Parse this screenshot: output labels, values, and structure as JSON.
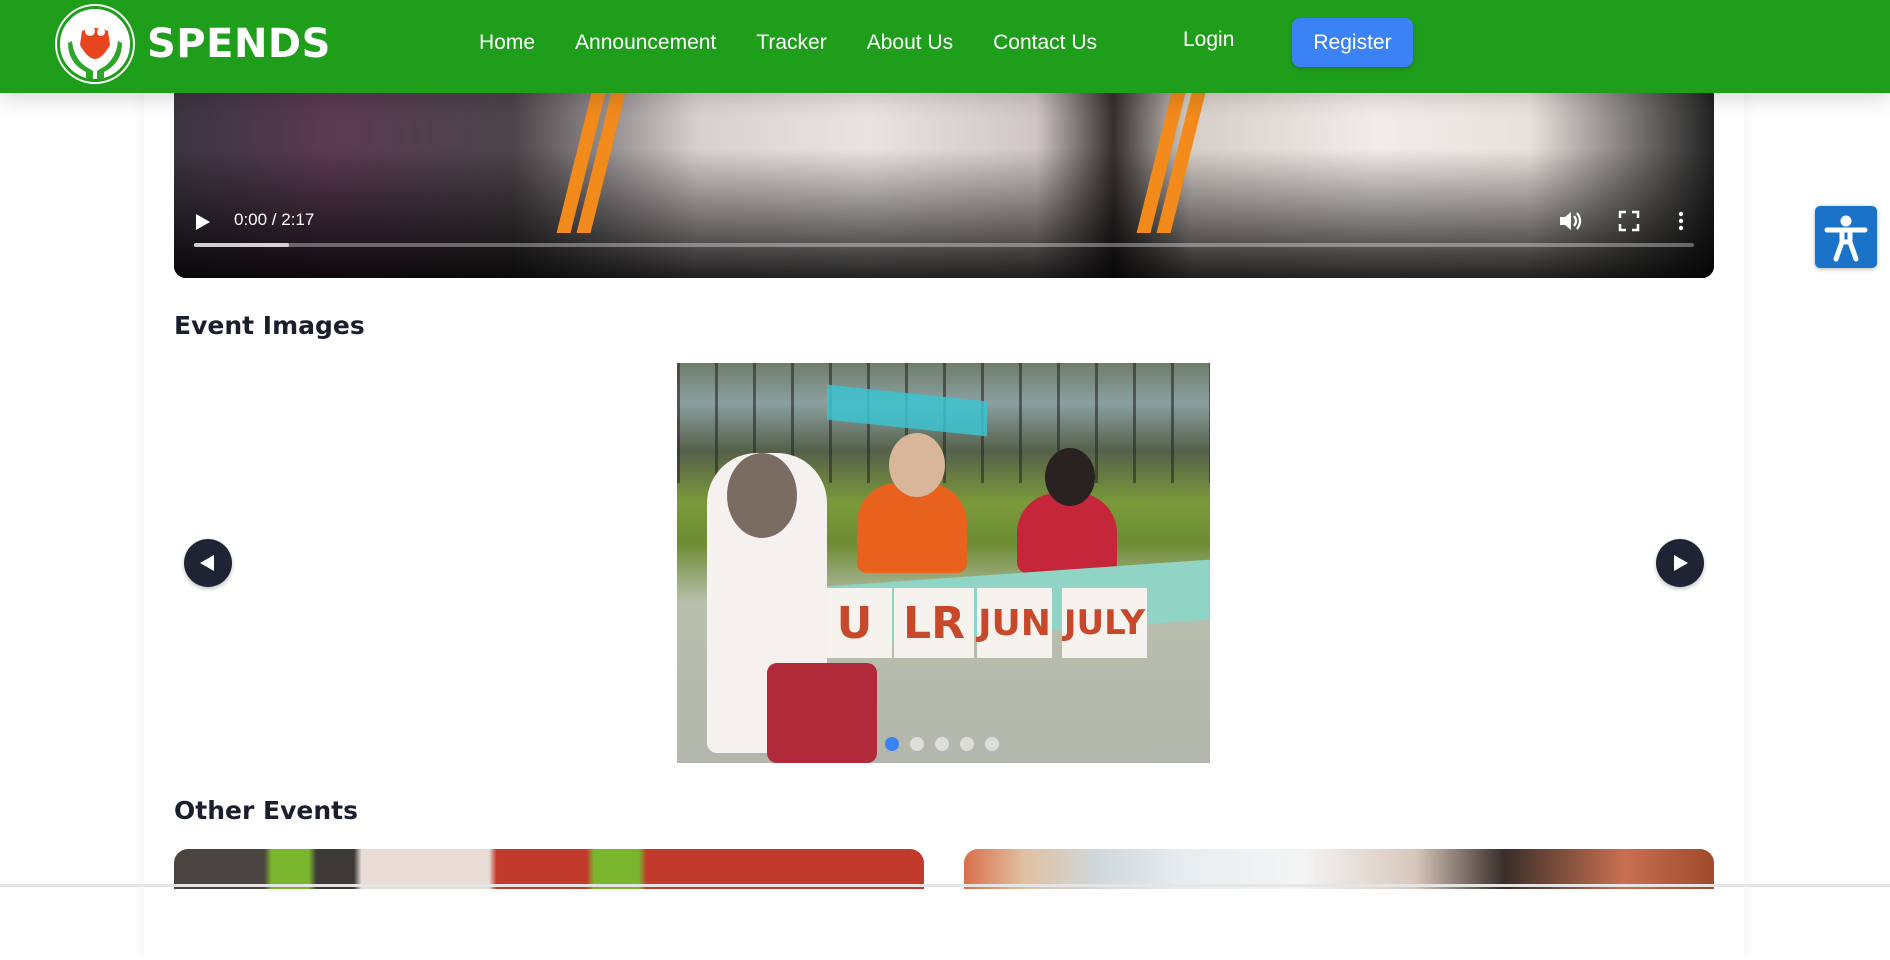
{
  "brand": {
    "name": "SPENDS",
    "logo_icon": "hands-holding-heart-logo"
  },
  "nav": {
    "links": [
      "Home",
      "Announcement",
      "Tracker",
      "About Us",
      "Contact Us"
    ],
    "login": "Login",
    "register": "Register"
  },
  "video": {
    "time_display": "0:00 / 2:17",
    "buffered_fraction": 0.063
  },
  "sections": {
    "event_images_title": "Event Images",
    "other_events_title": "Other Events"
  },
  "carousel": {
    "sign_labels": [
      "U",
      "LR",
      "JUN",
      "JULY"
    ],
    "slide_count": 5,
    "active_index": 0
  },
  "colors": {
    "navbar": "#1f9e1b",
    "register_button": "#3b82f6",
    "arrow_button": "#1e2433",
    "accessibility_button": "#1a73c9",
    "active_dot": "#3b82f6"
  },
  "icons": {
    "play": "play-icon",
    "volume": "volume-icon",
    "fullscreen": "fullscreen-icon",
    "more": "more-vertical-icon",
    "prev": "chevron-left-icon",
    "next": "chevron-right-icon",
    "accessibility": "accessibility-person-icon"
  }
}
